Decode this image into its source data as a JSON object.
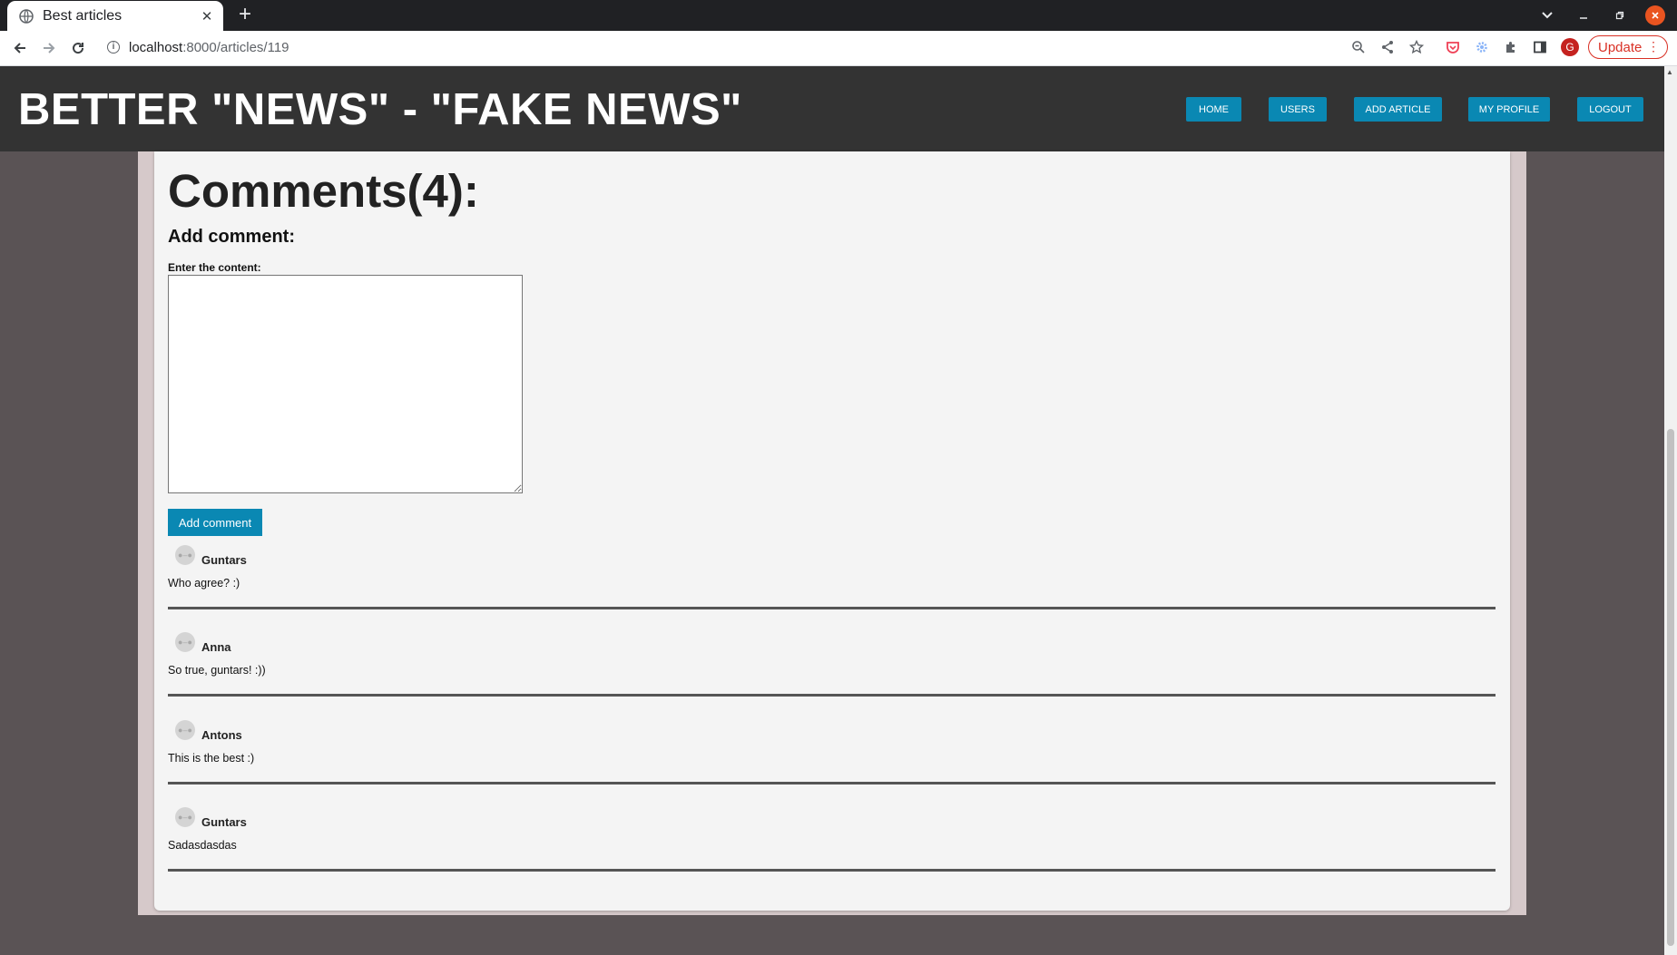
{
  "browser": {
    "tab_title": "Best articles",
    "tab_close": "✕",
    "new_tab": "+",
    "url_host": "localhost",
    "url_path": ":8000/articles/119",
    "update_label": "Update",
    "profile_initial": "G"
  },
  "site": {
    "title": "BETTER \"NEWS\" - \"FAKE NEWS\"",
    "nav": {
      "home": "HOME",
      "users": "USERS",
      "add_article": "ADD ARTICLE",
      "my_profile": "MY PROFILE",
      "logout": "LOGOUT"
    }
  },
  "comments": {
    "title": "Comments(4):",
    "form": {
      "heading": "Add comment:",
      "label": "Enter the content:",
      "content_value": "",
      "submit_label": "Add comment"
    },
    "items": [
      {
        "author": "Guntars",
        "text": "Who agree? :)"
      },
      {
        "author": "Anna",
        "text": "So true, guntars! :))"
      },
      {
        "author": "Antons",
        "text": "This is the best :)"
      },
      {
        "author": "Guntars",
        "text": "Sadasdasdas"
      }
    ]
  },
  "colors": {
    "header_bg": "#333333",
    "accent": "#0a88b3",
    "page_bg": "#5a5355",
    "content_bg": "#d6c9ca",
    "card_bg": "#f4f4f4"
  }
}
